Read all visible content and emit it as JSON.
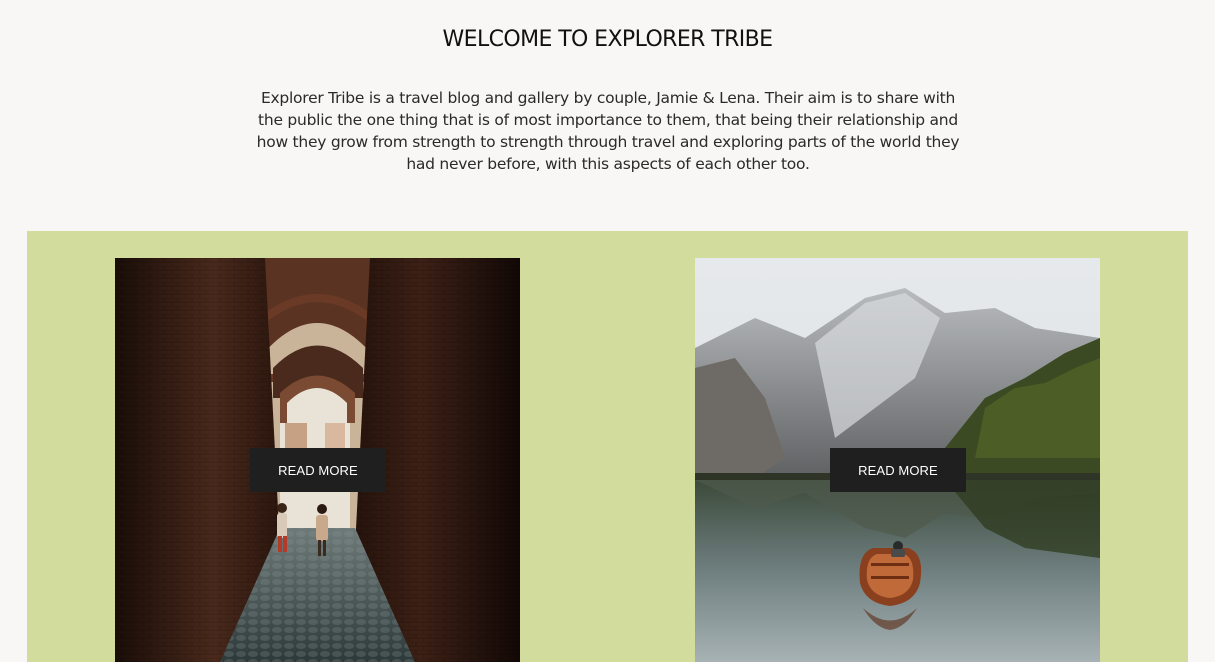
{
  "header": {
    "title": "WELCOME TO EXPLORER TRIBE",
    "intro": "Explorer Tribe is a travel blog and gallery by couple, Jamie & Lena. Their aim is to share with the public the one thing that is of most importance to them, that being their relationship and how they grow from strength to strength through travel and exploring parts of the world they had never before, with this aspects of each other too."
  },
  "colors": {
    "page_background": "#f8f7f5",
    "band_background": "#d2dd9d",
    "button_background": "#1f1f1f",
    "button_text": "#ffffff"
  },
  "gallery": {
    "cards": [
      {
        "image": "alley-photo",
        "button_label": "READ MORE"
      },
      {
        "image": "lake-boat-photo",
        "button_label": "READ MORE"
      }
    ]
  }
}
